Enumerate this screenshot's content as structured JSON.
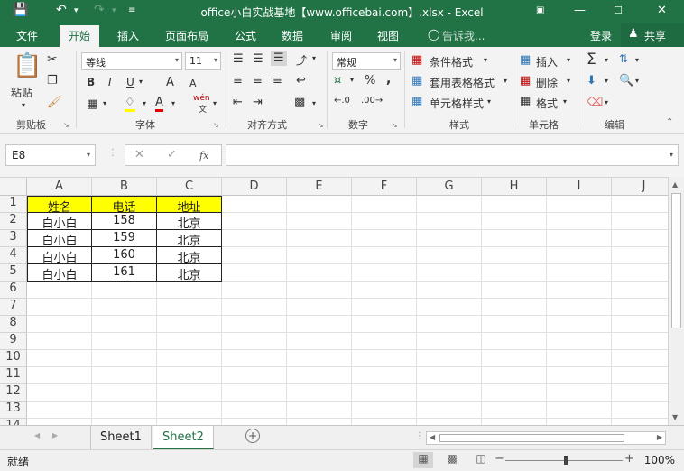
{
  "titlebar": {
    "title": "office小白实战基地【www.officebai.com】.xlsx - Excel",
    "save_icon": "save-icon",
    "undo_icon": "undo-icon",
    "redo_icon": "redo-icon"
  },
  "tabs": [
    "文件",
    "开始",
    "插入",
    "页面布局",
    "公式",
    "数据",
    "审阅",
    "视图"
  ],
  "tell_me": "告诉我...",
  "login": "登录",
  "share": "共享",
  "ribbon": {
    "paste": "粘贴",
    "clipboard_label": "剪贴板",
    "font_name": "等线",
    "font_size": "11",
    "font_label": "字体",
    "align_label": "对齐方式",
    "number_format": "常规",
    "number_label": "数字",
    "cond_format": "条件格式",
    "table_format": "套用表格格式",
    "cell_style": "单元格样式",
    "styles_label": "样式",
    "insert": "插入",
    "delete": "删除",
    "format": "格式",
    "cells_label": "单元格",
    "edit_label": "编辑",
    "bold": "B",
    "italic": "I",
    "underline": "U",
    "grow_font": "A",
    "shrink_font": "A",
    "font_color": "A",
    "wen": "wén",
    "percent": "%",
    "comma": ","
  },
  "formula_bar": {
    "name_box": "E8",
    "fx": "fx"
  },
  "grid": {
    "columns": [
      "A",
      "B",
      "C",
      "D",
      "E",
      "F",
      "G",
      "H",
      "I",
      "J"
    ],
    "rows": [
      "1",
      "2",
      "3",
      "4",
      "5",
      "6",
      "7",
      "8",
      "9",
      "10",
      "11",
      "12",
      "13",
      "14"
    ],
    "headers": [
      "姓名",
      "电话",
      "地址"
    ],
    "data": [
      [
        "白小白",
        "158",
        "北京"
      ],
      [
        "白小白",
        "159",
        "北京"
      ],
      [
        "白小白",
        "160",
        "北京"
      ],
      [
        "白小白",
        "161",
        "北京"
      ]
    ],
    "header_fill": "#ffff00"
  },
  "sheets": [
    "Sheet1",
    "Sheet2"
  ],
  "active_sheet": "Sheet2",
  "status": {
    "ready": "就绪",
    "zoom": "100%"
  },
  "colors": {
    "accent": "#217346"
  }
}
